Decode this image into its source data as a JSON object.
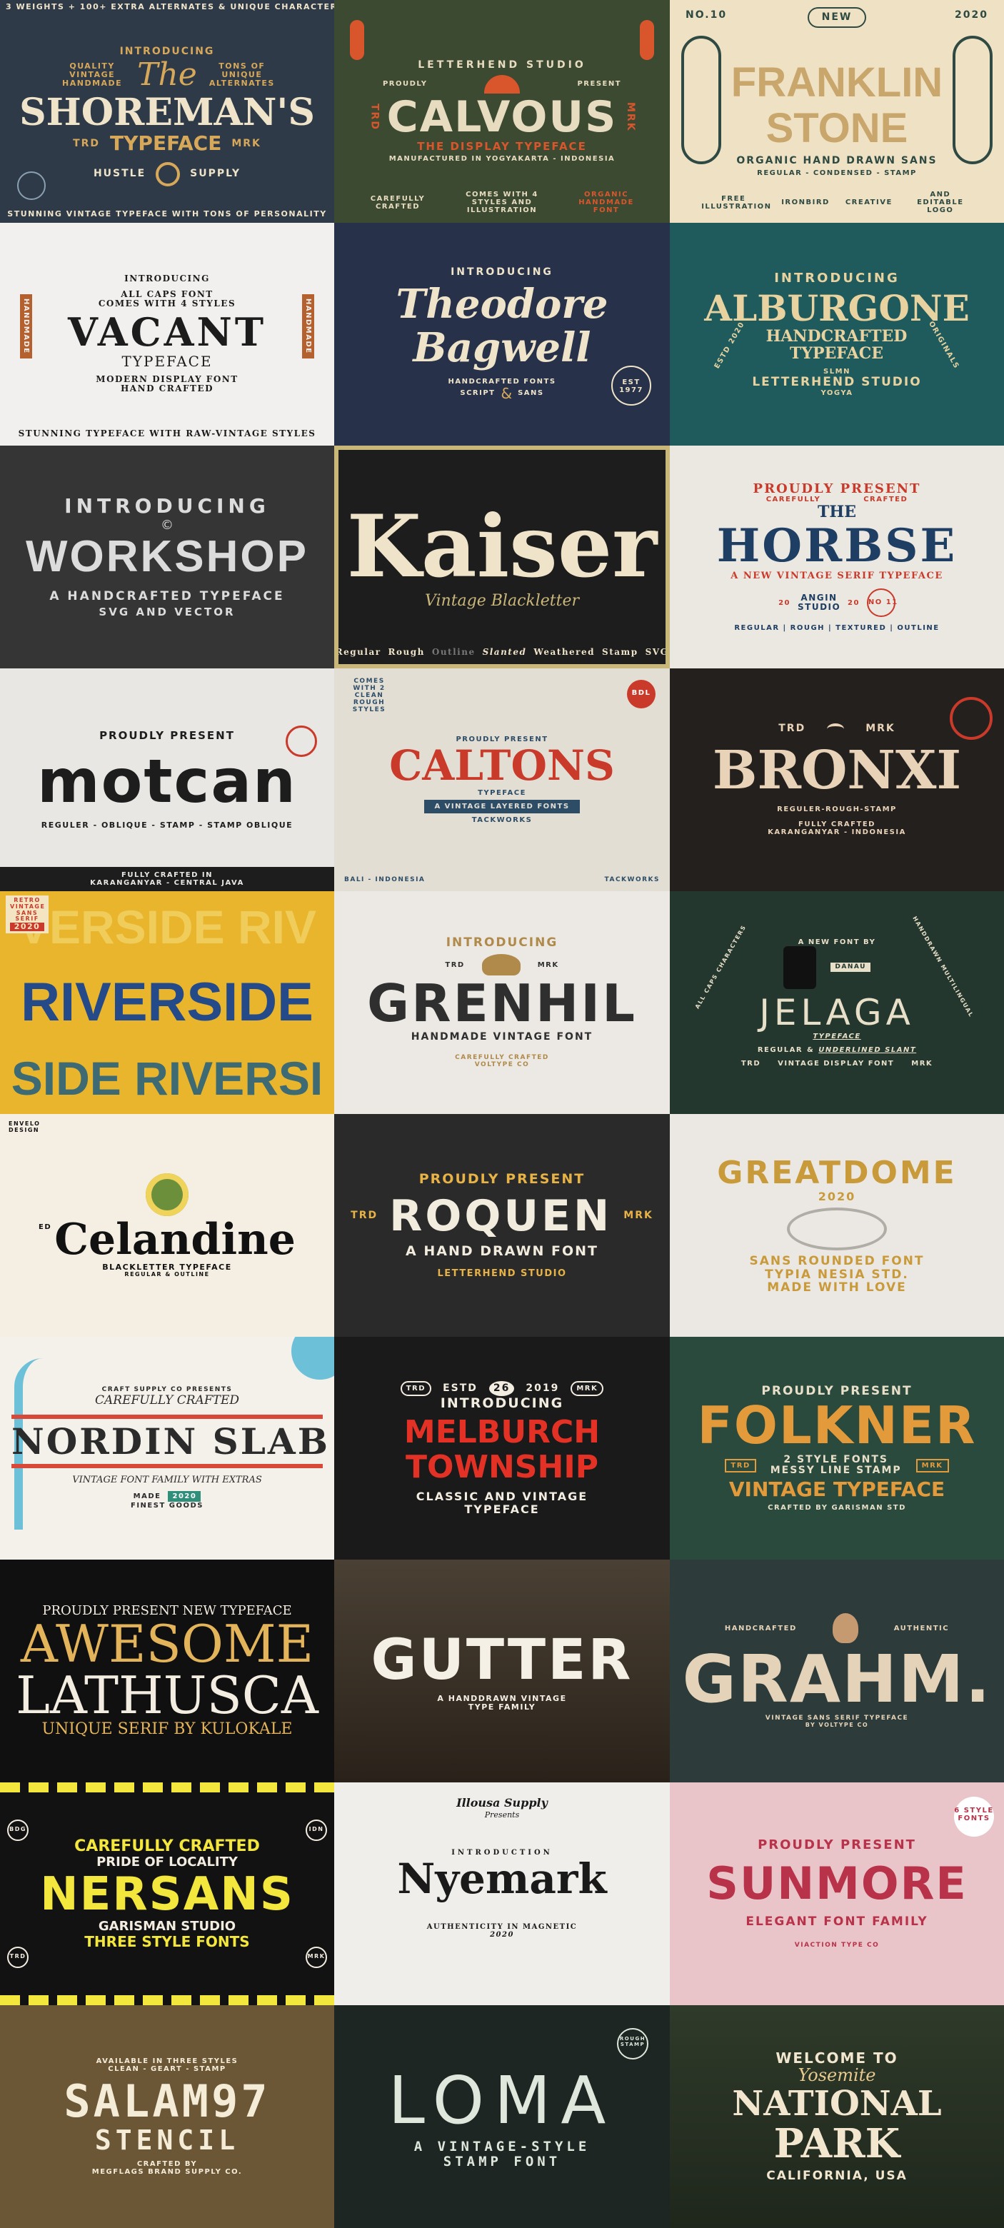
{
  "tiles": [
    {
      "name": "shoremans",
      "bg": "#2e3a47",
      "top": "3 WEIGHTS + 100+ EXTRA ALTERNATES & UNIQUE CHARACTERS",
      "intro": "INTRODUCING",
      "left": "QUALITY VINTAGE HANDMADE",
      "right": "TONS OF UNIQUE ALTERNATES",
      "title1": "The",
      "title2": "SHOREMAN'S",
      "trd": "TRD",
      "sub": "TYPEFACE",
      "mrk": "MRK",
      "hustle": "HUSTLE",
      "supply": "SUPPLY",
      "bottom": "STUNNING VINTAGE TYPEFACE WITH TONS OF PERSONALITY"
    },
    {
      "name": "calvous",
      "bg": "#3c4a31",
      "arc": "LETTERHEND STUDIO",
      "proudly": "PROUDLY",
      "present": "PRESENT",
      "trd": "TRD",
      "mrk": "MRK",
      "title": "CALVOUS",
      "sub": "THE DISPLAY TYPEFACE",
      "made": "MANUFACTURED IN YOGYAKARTA - INDONESIA",
      "f1": "CAREFULLY CRAFTED",
      "f2": "COMES WITH 4 STYLES AND ILLUSTRATION",
      "f3": "ORGANIC HANDMADE FONT"
    },
    {
      "name": "franklin",
      "bg": "#efe1c3",
      "no": "NO.10",
      "badge": "NEW",
      "year": "2020",
      "title1": "FRANKLIN",
      "title2": "STONE",
      "sub": "ORGANIC HAND DRAWN SANS",
      "styles": "REGULAR - CONDENSED - STAMP",
      "f1": "FREE ILLUSTRATION",
      "f2": "IRONBIRD",
      "f3": "CREATIVE",
      "f4": "AND EDITABLE LOGO"
    },
    {
      "name": "vacant",
      "bg": "#f2f0ee",
      "intro": "INTRODUCING",
      "all": "ALL CAPS FONT",
      "comes": "COMES WITH 4 STYLES",
      "title": "VACANT",
      "sub": "TYPEFACE",
      "modern": "MODERN DISPLAY FONT",
      "hand": "HAND CRAFTED",
      "side": "HANDMADE",
      "bottom": "STUNNING TYPEFACE WITH RAW-VINTAGE STYLES"
    },
    {
      "name": "theodore",
      "bg": "#27324a",
      "intro": "INTRODUCING",
      "title1": "Theodore",
      "title2": "Bagwell",
      "est": "EST 1977",
      "sub": "HANDCRAFTED FONTS",
      "sub2": "SCRIPT",
      "amp": "&",
      "sub3": "SANS"
    },
    {
      "name": "alburgone",
      "bg": "#1f5a5c",
      "intro": "INTRODUCING",
      "title": "ALBURGONE",
      "hand": "HANDCRAFTED",
      "sub": "TYPEFACE",
      "left": "ESTD 2020",
      "right": "ORIGINALS",
      "slmn": "SLMN",
      "studio": "LETTERHEND STUDIO",
      "city": "YOGYA"
    },
    {
      "name": "workshop",
      "bg": "#353535",
      "intro": "INTRODUCING",
      "title": "WORKSHOP",
      "sub": "A HANDCRAFTED TYPEFACE",
      "sub2": "SVG AND VECTOR"
    },
    {
      "name": "kaiser",
      "bg": "#1d1d1d",
      "title": "Kaiser",
      "sub": "Vintage Blackletter",
      "styles": [
        "Regular",
        "Rough",
        "Outline",
        "Slanted",
        "Weathered",
        "Stamp",
        "SVG"
      ]
    },
    {
      "name": "horbse",
      "bg": "#ebe7e1",
      "proud": "PROUDLY PRESENT",
      "cc1": "CAREFULLY",
      "cc2": "CRAFTED",
      "the": "THE",
      "title": "HORBSE",
      "sub": "A NEW VINTAGE SERIF TYPEFACE",
      "angin": "ANGIN STUDIO",
      "y1": "20",
      "y2": "20",
      "no": "NO 11",
      "styles": "REGULAR | ROUGH | TEXTURED | OUTLINE"
    },
    {
      "name": "motcan",
      "bg": "#e9e7e3",
      "proud": "PROUDLY PRESENT",
      "title": "motcan",
      "styles": "REGULER - OBLIQUE - STAMP - STAMP OBLIQUE",
      "f1": "FULLY CRAFTED IN",
      "f2": "KARANGANYAR - CENTRAL JAVA"
    },
    {
      "name": "caltons",
      "bg": "#e3ded4",
      "comes": "COMES WITH 2 CLEAN ROUGH STYLES",
      "proud": "PROUDLY PRESENT",
      "title": "CALTONS",
      "sub": "TYPEFACE",
      "sub2": "A VINTAGE LAYERED FONTS",
      "by": "TACKWORKS",
      "badge": "BDL",
      "f1": "BALI - INDONESIA",
      "f2": "TACKWORKS"
    },
    {
      "name": "bronxi",
      "bg": "#24201e",
      "trd": "TRD",
      "mrk": "MRK",
      "title": "BRONXI",
      "styles": "REGULER-ROUGH-STAMP",
      "f1": "FULLY CRAFTED",
      "f2": "KARANGANYAR - INDONESIA"
    },
    {
      "name": "riverside",
      "bg": "#e8b52c",
      "stamp1": "RETRO VINTAGE SANS SERIF",
      "stamp2": "2020",
      "r1": "VERSIDE RIV",
      "r2": "RIVERSIDE",
      "r3": "SIDE RIVERSI"
    },
    {
      "name": "grenhil",
      "bg": "#ece9e4",
      "intro": "INTRODUCING",
      "trd": "TRD",
      "mrk": "MRK",
      "title": "GRENHIL",
      "sub": "HANDMADE VINTAGE FONT",
      "f1": "CAREFULLY CRAFTED",
      "f2": "VOLTYPE CO"
    },
    {
      "name": "jelaga",
      "bg": "#24372f",
      "arc": "A NEW FONT BY",
      "flag": "DANAU",
      "left": "ALL CAPS CHARACTERS",
      "right": "HANDDRAWN MULTILINGUAL",
      "title": "JELAGA",
      "sub": "TYPEFACE",
      "reg": "REGULAR",
      "amp": "&",
      "under": "UNDERLINED SLANT",
      "vint": "VINTAGE DISPLAY FONT",
      "trd": "TRD",
      "mrk": "MRK"
    },
    {
      "name": "celandine",
      "bg": "#f5efe3",
      "corner": "ENVELO DESIGN",
      "ed": "ED",
      "title": "Celandine",
      "sub": "BLACKLETTER TYPEFACE",
      "sub2": "REGULAR & OUTLINE"
    },
    {
      "name": "roquen",
      "bg": "#2a2a2a",
      "proud": "PROUDLY PRESENT",
      "trd": "TRD",
      "mrk": "MRK",
      "title": "ROQUEN",
      "sub": "A HAND DRAWN FONT",
      "studio": "LETTERHEND STUDIO"
    },
    {
      "name": "greatdome",
      "bg": "#ebe8e4",
      "title": "GREATDOME",
      "year": "2020",
      "l1": "SANS ROUNDED FONT",
      "l2": "TYPIA NESIA STD.",
      "l3": "MADE WITH LOVE"
    },
    {
      "name": "nordin",
      "bg": "#f4f0ea",
      "supply": "CRAFT SUPPLY CO PRESENTS",
      "cc": "CAREFULLY CRAFTED",
      "title": "NORDIN SLAB",
      "sub": "VINTAGE FONT FAMILY WITH EXTRAS",
      "made": "MADE",
      "year": "2020",
      "finest": "FINEST GOODS"
    },
    {
      "name": "melburch",
      "bg": "#1a1a1a",
      "estd": "ESTD",
      "num": "26",
      "year": "2019",
      "trd": "TRD",
      "mrk": "MRK",
      "intro": "INTRODUCING",
      "title1": "MELBURCH",
      "title2": "TOWNSHIP",
      "sub1": "CLASSIC AND VINTAGE",
      "sub2": "TYPEFACE"
    },
    {
      "name": "folkner",
      "bg": "#2a4a3e",
      "proud": "PROUDLY PRESENT",
      "title": "FOLKNER",
      "trd": "TRD",
      "mrk": "MRK",
      "l1": "2 STYLE FONTS",
      "l2": "MESSY LINE STAMP",
      "sub": "VINTAGE TYPEFACE",
      "by": "CRAFTED BY GARISMAN STD"
    },
    {
      "name": "lathusca",
      "bg": "#101010",
      "top": "PROUDLY PRESENT NEW TYPEFACE",
      "t1": "AWESOME",
      "t2": "LATHUSCA",
      "sub": "UNIQUE SERIF BY KULOKALE"
    },
    {
      "name": "gutter",
      "bg": "#3a3026",
      "title": "GUTTER",
      "sub1": "A HANDDRAWN VINTAGE",
      "sub2": "TYPE FAMILY"
    },
    {
      "name": "grahm",
      "bg": "#2d3c3b",
      "left": "HANDCRAFTED",
      "right": "AUTHENTIC",
      "title": "GRAHM.",
      "sub": "VINTAGE SANS SERIF TYPEFACE",
      "by": "BY VOLTYPE CO"
    },
    {
      "name": "nersans",
      "bg": "#121212",
      "cc": "CAREFULLY CRAFTED",
      "pride": "PRIDE OF LOCALITY",
      "title": "NERSANS",
      "studio": "GARISMAN STUDIO",
      "three": "THREE STYLE FONTS",
      "bdg": "BDG",
      "idn": "IDN",
      "trd": "TRD",
      "mrk": "MRK"
    },
    {
      "name": "nyemark",
      "bg": "#efeeeb",
      "supply": "Illousa Supply",
      "presents": "Presents",
      "intro": "INTRODUCTION",
      "title": "Nyemark",
      "auth": "AUTHENTICITY IN MAGNETIC",
      "year": "2020"
    },
    {
      "name": "sunmore",
      "bg": "#e9c4c9",
      "proud": "PROUDLY PRESENT",
      "badge": "6 STYLE FONTS",
      "title": "SUNMORE",
      "sub": "ELEGANT FONT FAMILY",
      "co": "VIACTION TYPE CO"
    },
    {
      "name": "salam97",
      "bg": "#6b5636",
      "avail": "AVAILABLE IN THREE STYLES",
      "styles": "CLEAN - GEART - STAMP",
      "title1": "SALAM97",
      "title2": "STENCIL",
      "crafted": "CRAFTED BY",
      "by": "MEGFLAGS BRAND SUPPLY CO."
    },
    {
      "name": "loma",
      "bg": "#1e2624",
      "title": "LOMA",
      "sub1": "A VINTAGE-STYLE",
      "sub2": "STAMP FONT",
      "badge": "ROUGH STAMP"
    },
    {
      "name": "nationalpark",
      "bg": "#2f3a2a",
      "welcome": "WELCOME TO",
      "yosemite": "Yosemite",
      "t1": "NATIONAL",
      "t2": "PARK",
      "loc": "CALIFORNIA, USA"
    }
  ],
  "colors": {
    "cream": "#efe4c9",
    "gold": "#d7a85a",
    "red": "#c93a2a",
    "teal": "#1f5a5c",
    "navy": "#1e3f63",
    "blue": "#244a8a",
    "yellow": "#f3e63d",
    "orange": "#e39a3a",
    "pinkred": "#b8324a"
  }
}
